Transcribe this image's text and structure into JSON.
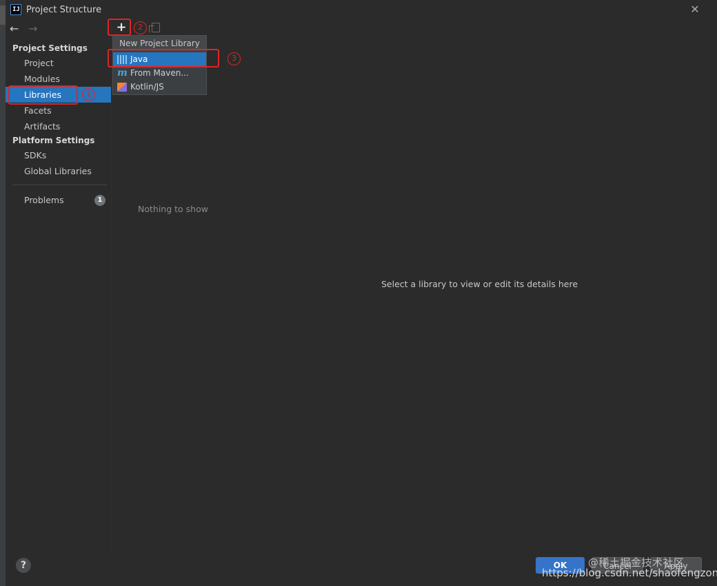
{
  "window": {
    "app_icon": "IJ",
    "title": "Project Structure",
    "close_label": "✕"
  },
  "nav": {
    "back_label": "←",
    "forward_label": "→"
  },
  "sidebar": {
    "project_settings_header": "Project Settings",
    "project_items": [
      "Project",
      "Modules",
      "Libraries",
      "Facets",
      "Artifacts"
    ],
    "platform_settings_header": "Platform Settings",
    "platform_items": [
      "SDKs",
      "Global Libraries"
    ],
    "problems_label": "Problems",
    "problems_count": "1",
    "selected_item": "Libraries"
  },
  "toolbar": {
    "add_label": "+"
  },
  "popup": {
    "title": "New Project Library",
    "items": [
      "Java",
      "From Maven...",
      "Kotlin/JS"
    ],
    "maven_icon_glyph": "m",
    "selected_item": "Java"
  },
  "annotations": {
    "step1": "1",
    "step2": "2",
    "step3": "3",
    "color": "#e02424"
  },
  "content": {
    "empty_list": "Nothing to show",
    "details_hint": "Select a library to view or edit its details here"
  },
  "footer": {
    "help_label": "?",
    "ok_label": "OK",
    "cancel_label": "Cancel",
    "apply_label": "Apply"
  },
  "watermark": {
    "line1": "@稀土掘金技术社区",
    "line2": "https://blog.csdn.net/shaofengzong"
  },
  "colors": {
    "background": "#2b2b2b",
    "selection": "#2675bf",
    "ok_button": "#3574c8"
  }
}
